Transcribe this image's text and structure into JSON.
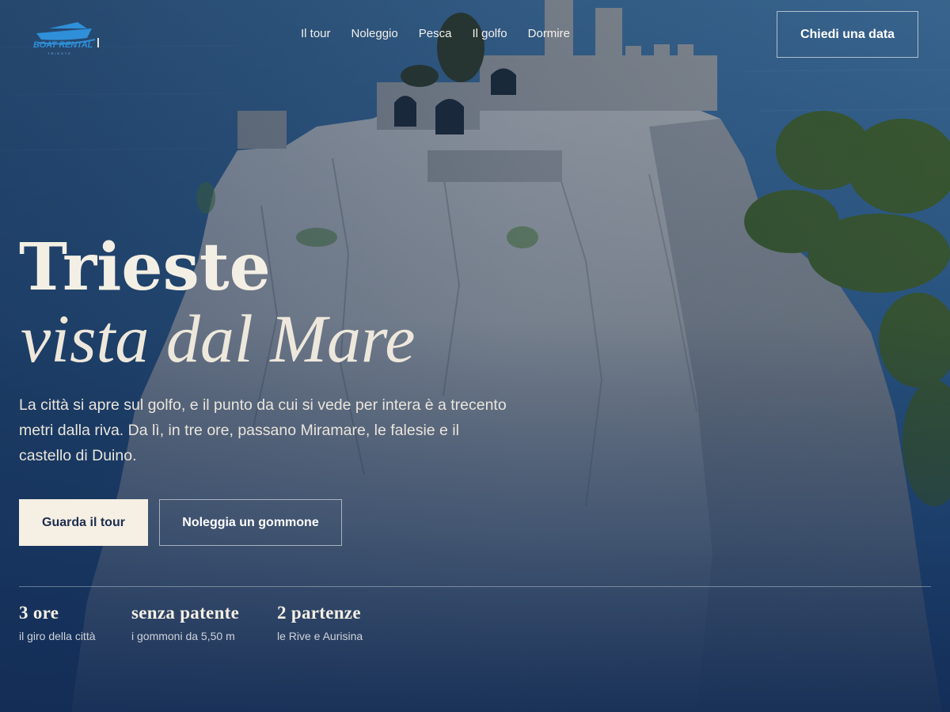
{
  "brand": {
    "name": "BOAT RENTAL",
    "tagline": "TRIESTE"
  },
  "nav": {
    "items": [
      {
        "label": "Il tour"
      },
      {
        "label": "Noleggio"
      },
      {
        "label": "Pesca"
      },
      {
        "label": "Il golfo"
      },
      {
        "label": "Dormire"
      }
    ],
    "cta": "Chiedi una data"
  },
  "hero": {
    "title_line1": "Trieste",
    "title_line2": "vista dal Mare",
    "description": "La città si apre sul golfo, e il punto da cui si vede per intera è a trecento metri dalla riva. Da lì, in tre ore, passano Miramare, le falesie e il castello di Duino.",
    "primary_button": "Guarda il tour",
    "secondary_button": "Noleggia un gommone"
  },
  "stats": [
    {
      "value": "3 ore",
      "label": "il giro della città"
    },
    {
      "value": "senza patente",
      "label": "i gommoni da 5,50 m"
    },
    {
      "value": "2 partenze",
      "label": "le Rive e Aurisina"
    }
  ],
  "colors": {
    "sea": "#2f5b86",
    "overlay": "#1c3358",
    "cream": "#f6efe3",
    "logo_blue": "#2f8fd8"
  }
}
